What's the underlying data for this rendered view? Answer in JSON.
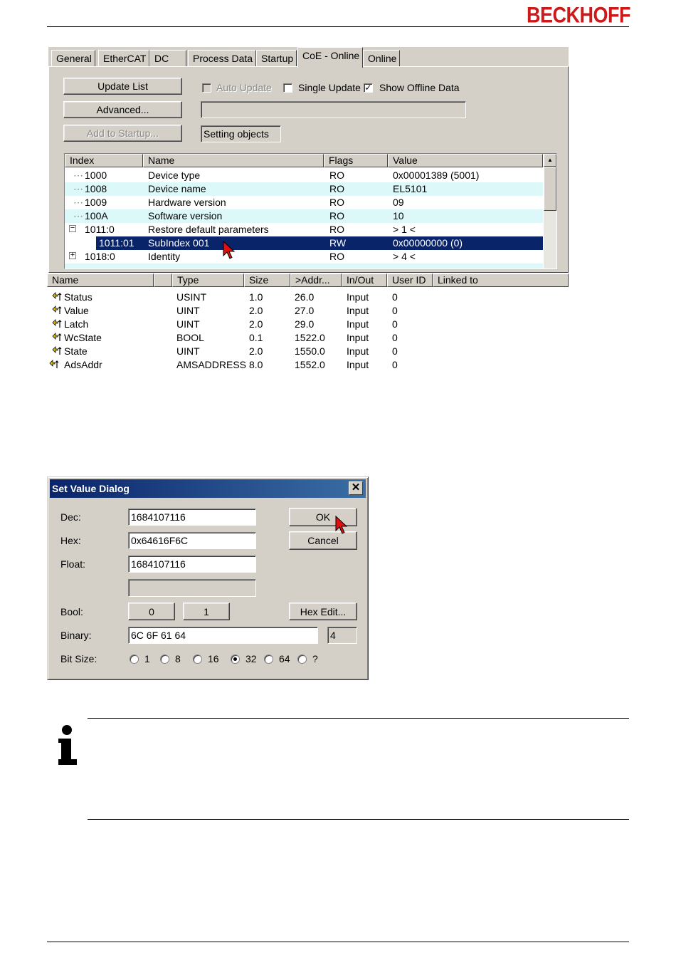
{
  "header": {
    "brand": "BECKHOFF"
  },
  "tabs": [
    {
      "label": "General"
    },
    {
      "label": "EtherCAT"
    },
    {
      "label": "DC"
    },
    {
      "label": "Process Data"
    },
    {
      "label": "Startup"
    },
    {
      "label": "CoE - Online"
    },
    {
      "label": "Online"
    }
  ],
  "coe": {
    "update_list": "Update List",
    "advanced": "Advanced...",
    "add_to_startup": "Add to Startup...",
    "auto_update": "Auto Update",
    "single_update": "Single Update",
    "show_offline": "Show Offline Data",
    "status_text": "Setting objects",
    "columns": {
      "index": "Index",
      "name": "Name",
      "flags": "Flags",
      "value": "Value"
    },
    "rows": [
      {
        "index": "1000",
        "name": "Device type",
        "flags": "RO",
        "value": "0x00001389 (5001)"
      },
      {
        "index": "1008",
        "name": "Device name",
        "flags": "RO",
        "value": "EL5101"
      },
      {
        "index": "1009",
        "name": "Hardware version",
        "flags": "RO",
        "value": "09"
      },
      {
        "index": "100A",
        "name": "Software version",
        "flags": "RO",
        "value": "10"
      },
      {
        "index": "1011:0",
        "name": "Restore default parameters",
        "flags": "RO",
        "value": "> 1 <"
      },
      {
        "index": "1011:01",
        "name": "SubIndex 001",
        "flags": "RW",
        "value": "0x00000000 (0)"
      },
      {
        "index": "1018:0",
        "name": "Identity",
        "flags": "RO",
        "value": "> 4 <"
      }
    ]
  },
  "vars": {
    "columns": {
      "name": "Name",
      "type": "Type",
      "size": "Size",
      "addr": ">Addr...",
      "inout": "In/Out",
      "userid": "User ID",
      "linked": "Linked to"
    },
    "rows": [
      {
        "name": "Status",
        "type": "USINT",
        "size": "1.0",
        "addr": "26.0",
        "inout": "Input",
        "userid": "0"
      },
      {
        "name": "Value",
        "type": "UINT",
        "size": "2.0",
        "addr": "27.0",
        "inout": "Input",
        "userid": "0"
      },
      {
        "name": "Latch",
        "type": "UINT",
        "size": "2.0",
        "addr": "29.0",
        "inout": "Input",
        "userid": "0"
      },
      {
        "name": "WcState",
        "type": "BOOL",
        "size": "0.1",
        "addr": "1522.0",
        "inout": "Input",
        "userid": "0"
      },
      {
        "name": "State",
        "type": "UINT",
        "size": "2.0",
        "addr": "1550.0",
        "inout": "Input",
        "userid": "0"
      },
      {
        "name": "AdsAddr",
        "type": "AMSADDRESS",
        "size": "8.0",
        "addr": "1552.0",
        "inout": "Input",
        "userid": "0"
      }
    ]
  },
  "dialog": {
    "title": "Set Value Dialog",
    "dec_label": "Dec:",
    "dec_value": "1684107116",
    "hex_label": "Hex:",
    "hex_value": "0x64616F6C",
    "float_label": "Float:",
    "float_value": "1684107116",
    "ok": "OK",
    "cancel": "Cancel",
    "bool_label": "Bool:",
    "bool_0": "0",
    "bool_1": "1",
    "hex_edit": "Hex Edit...",
    "binary_label": "Binary:",
    "binary_value": "6C 6F 61 64",
    "binary_len": "4",
    "bitsize_label": "Bit Size:",
    "bitsizes": [
      "1",
      "8",
      "16",
      "32",
      "64",
      "?"
    ],
    "bitsize_selected": "32"
  },
  "colors": {
    "brand": "#cc1a1a",
    "selection": "#0a246a",
    "alt_row": "#dcf8f8",
    "face": "#d4d0c8"
  }
}
